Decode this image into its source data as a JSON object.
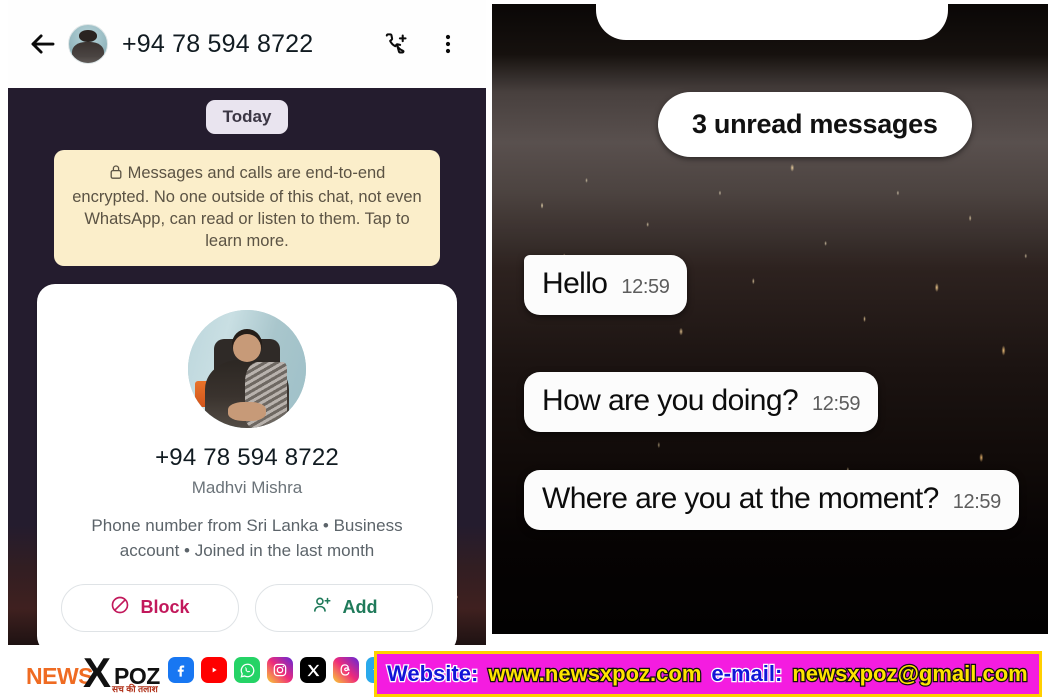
{
  "left_panel": {
    "header": {
      "back_icon": "back-arrow-icon",
      "avatar": "contact-avatar",
      "title": "+94 78 594 8722",
      "call_icon": "phone-add-icon",
      "menu_icon": "overflow-menu-icon"
    },
    "day_divider": "Today",
    "encryption_notice": {
      "lock_icon": "lock-icon",
      "text": "Messages and calls are end-to-end encrypted. No one outside of this chat, not even WhatsApp, can read or listen to them. Tap to learn more."
    },
    "contact_card": {
      "avatar": "profile-photo",
      "number": "+94 78 594 8722",
      "name": "Madhvi Mishra",
      "meta": "Phone number from Sri Lanka • Business account • Joined in the last month",
      "block_button": {
        "label": "Block",
        "icon": "block-icon",
        "color": "#c2185b"
      },
      "add_button": {
        "label": "Add",
        "icon": "add-person-icon",
        "color": "#1f7a5a"
      }
    }
  },
  "right_panel": {
    "unread_banner": "3 unread messages",
    "messages": [
      {
        "text": "Hello",
        "time": "12:59"
      },
      {
        "text": "How are you doing?",
        "time": "12:59"
      },
      {
        "text": "Where are you at the moment?",
        "time": "12:59"
      }
    ]
  },
  "footer": {
    "logo": {
      "part1": "NEWS",
      "part2": "X",
      "part3": "POZ",
      "tagline": "सच की तलाश"
    },
    "socials": [
      {
        "name": "facebook-icon",
        "glyph": "f"
      },
      {
        "name": "youtube-icon",
        "glyph": "▶"
      },
      {
        "name": "whatsapp-icon",
        "glyph": "✆"
      },
      {
        "name": "instagram-icon",
        "glyph": "◎"
      },
      {
        "name": "x-twitter-icon",
        "glyph": "𝕏"
      },
      {
        "name": "threads-icon",
        "glyph": "@"
      },
      {
        "name": "telegram-icon",
        "glyph": "➤"
      }
    ],
    "website_label": "Website:",
    "website_value": "www.newsxpoz.com",
    "email_label": "e-mail:",
    "email_value": "newsxpoz@gmail.com"
  }
}
